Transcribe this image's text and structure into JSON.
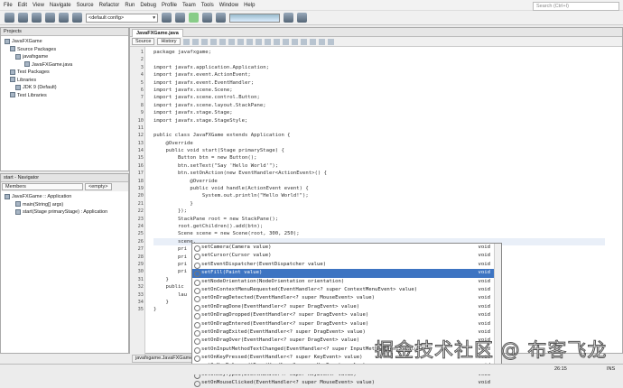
{
  "menu": [
    "File",
    "Edit",
    "View",
    "Navigate",
    "Source",
    "Refactor",
    "Run",
    "Debug",
    "Profile",
    "Team",
    "Tools",
    "Window",
    "Help"
  ],
  "search_placeholder": "Search (Ctrl+I)",
  "toolbar": {
    "config": "<default config>"
  },
  "projects": {
    "title": "Projects",
    "tree": [
      "JavaFXGame",
      "Source Packages",
      "javafxgame",
      "JavaFXGame.java",
      "Test Packages",
      "Libraries",
      "JDK 9 (Default)",
      "Test Libraries"
    ]
  },
  "navigator": {
    "title": "start - Navigator",
    "filter": "Members",
    "empty": "<empty>",
    "tree": [
      "JavaFXGame :: Application",
      "main(String[] args)",
      "start(Stage primaryStage) : Application"
    ]
  },
  "editor": {
    "tab": "JavaFXGame.java",
    "source": "Source",
    "history": "History",
    "bottom_tab": "javafxgame.JavaFXGame"
  },
  "code": [
    "package javafxgame;",
    "",
    "import javafx.application.Application;",
    "import javafx.event.ActionEvent;",
    "import javafx.event.EventHandler;",
    "import javafx.scene.Scene;",
    "import javafx.scene.control.Button;",
    "import javafx.scene.layout.StackPane;",
    "import javafx.stage.Stage;",
    "import javafx.stage.StageStyle;",
    "",
    "public class JavaFXGame extends Application {",
    "    @Override",
    "    public void start(Stage primaryStage) {",
    "        Button btn = new Button();",
    "        btn.setText(\"Say 'Hello World'\");",
    "        btn.setOnAction(new EventHandler<ActionEvent>() {",
    "            @Override",
    "            public void handle(ActionEvent event) {",
    "                System.out.println(\"Hello World!\");",
    "            }",
    "        });",
    "        StackPane root = new StackPane();",
    "        root.getChildren().add(btn);",
    "        Scene scene = new Scene(root, 300, 250);",
    "        scene.",
    "        pri",
    "        pri",
    "        pri",
    "        pri",
    "    }",
    "    public",
    "        lau",
    "    }",
    "}"
  ],
  "completion": [
    [
      "setCamera(Camera value)",
      "void"
    ],
    [
      "setCursor(Cursor value)",
      "void"
    ],
    [
      "setEventDispatcher(EventDispatcher value)",
      "void"
    ],
    [
      "setFill(Paint value)",
      "void"
    ],
    [
      "setNodeOrientation(NodeOrientation orientation)",
      "void"
    ],
    [
      "setOnContextMenuRequested(EventHandler<? super ContextMenuEvent> value)",
      "void"
    ],
    [
      "setOnDragDetected(EventHandler<? super MouseEvent> value)",
      "void"
    ],
    [
      "setOnDragDone(EventHandler<? super DragEvent> value)",
      "void"
    ],
    [
      "setOnDragDropped(EventHandler<? super DragEvent> value)",
      "void"
    ],
    [
      "setOnDragEntered(EventHandler<? super DragEvent> value)",
      "void"
    ],
    [
      "setOnDragExited(EventHandler<? super DragEvent> value)",
      "void"
    ],
    [
      "setOnDragOver(EventHandler<? super DragEvent> value)",
      "void"
    ],
    [
      "setOnInputMethodTextChanged(EventHandler<? super InputMethodEvent> value)",
      "void"
    ],
    [
      "setOnKeyPressed(EventHandler<? super KeyEvent> value)",
      "void"
    ],
    [
      "setOnKeyReleased(EventHandler<? super KeyEvent> value)",
      "void"
    ],
    [
      "setOnKeyTyped(EventHandler<? super KeyEvent> value)",
      "void"
    ],
    [
      "setOnMouseClicked(EventHandler<? super MouseEvent> value)",
      "void"
    ]
  ],
  "status": {
    "position": "26:15",
    "mode": "INS"
  },
  "watermark": "掘金技术社区 @ 布客飞龙"
}
